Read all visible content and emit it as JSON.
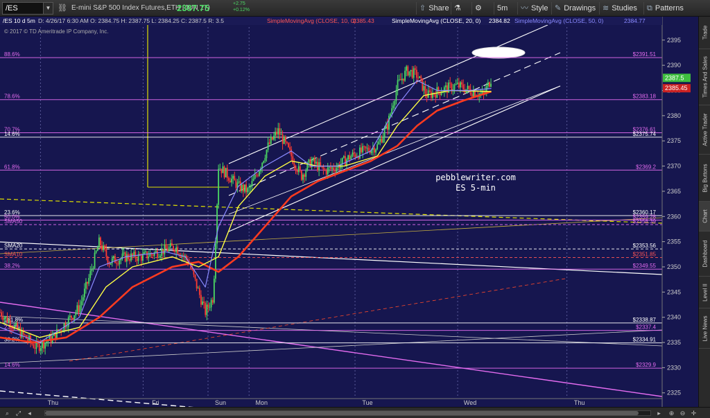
{
  "toolbar": {
    "symbol": "/ES",
    "symbol_dropdown": "▼",
    "description": "E-mini S&P 500 Index Futures,ETH (JUN 17)",
    "last_price": "2387.75",
    "change_top": "+2.75",
    "change_bottom": "+0.12%",
    "share_label": "Share",
    "timeframe_label": "5m",
    "style_label": "Style",
    "drawings_label": "Drawings",
    "studies_label": "Studies",
    "patterns_label": "Patterns",
    "icons": [
      "link-icon",
      "flask-icon",
      "gear-icon",
      "share-icon",
      "drawings-icon",
      "studies-icon",
      "patterns-icon"
    ]
  },
  "legend": {
    "header": "/ES 10 d 5m",
    "ohlc": "D: 4/26/17 6:30 AM   O: 2384.75   H: 2387.75   L: 2384.25   C: 2387.5   R: 3.5",
    "sma10_label": "SimpleMovingAvg (CLOSE, 10, 0)",
    "sma10_value": "2385.43",
    "sma20_label": "SimpleMovingAvg (CLOSE, 20, 0)",
    "sma20_value": "2384.82",
    "sma50_label": "SimpleMovingAvg (CLOSE, 50, 0)",
    "sma50_value": "2384.77",
    "copyright": "© 2017 © TD Ameritrade IP Company, Inc."
  },
  "watermark": {
    "line1": "pebblewriter.com",
    "line2": "ES 5-min"
  },
  "y_axis": {
    "min": 2324,
    "max": 2398,
    "ticks": [
      2395,
      2390,
      2385,
      2380,
      2375,
      2370,
      2365,
      2360,
      2355,
      2350,
      2345,
      2340,
      2335,
      2330,
      2325
    ]
  },
  "price_tags": [
    {
      "value": "2387.5",
      "color": "#3fbf3f"
    },
    {
      "value": "2385.45",
      "color": "#cc2222"
    }
  ],
  "x_axis": {
    "labels": [
      {
        "text": "Thu",
        "pos": 0.08
      },
      {
        "text": "Fri",
        "pos": 0.235
      },
      {
        "text": "Sun",
        "pos": 0.333
      },
      {
        "text": "Mon",
        "pos": 0.395
      },
      {
        "text": "Tue",
        "pos": 0.555
      },
      {
        "text": "Wed",
        "pos": 0.71
      },
      {
        "text": "Thu",
        "pos": 0.875
      }
    ]
  },
  "levels": [
    {
      "label": "88.6%",
      "value_text": "$2391.51",
      "price": 2391.51,
      "color": "#e46cf0",
      "style": "solid"
    },
    {
      "label": "78.6%",
      "value_text": "$2383.18",
      "price": 2383.18,
      "color": "#e46cf0",
      "style": "solid"
    },
    {
      "label": "70.7%",
      "value_text": "$2376.61",
      "price": 2376.61,
      "color": "#e46cf0",
      "style": "solid"
    },
    {
      "label": "14.6%",
      "value_text": "$2375.74",
      "price": 2375.74,
      "color": "#ffffff",
      "style": "solid"
    },
    {
      "label": "61.8%",
      "value_text": "$2369.2",
      "price": 2369.2,
      "color": "#e46cf0",
      "style": "solid"
    },
    {
      "label": "23.6%",
      "value_text": "$2360.17",
      "price": 2360.17,
      "color": "#ffffff",
      "style": "solid"
    },
    {
      "label": "50.0%",
      "value_text": "$2359.28",
      "price": 2359.28,
      "color": "#e46cf0",
      "style": "solid"
    },
    {
      "label": "SMA50",
      "value_text": "$2358.39",
      "price": 2358.39,
      "color": "#e46cf0",
      "style": "dashed"
    },
    {
      "label": "SMA20",
      "value_text": "$2353.56",
      "price": 2353.56,
      "color": "#ffffff",
      "style": "dashed"
    },
    {
      "label": "SMA10",
      "value_text": "$2351.85",
      "price": 2351.85,
      "color": "#ff5555",
      "style": "dashed"
    },
    {
      "label": "38.2%",
      "value_text": "$2349.55",
      "price": 2349.55,
      "color": "#e46cf0",
      "style": "solid"
    },
    {
      "label": "161.8%",
      "value_text": "$2338.87",
      "price": 2338.87,
      "color": "#ffffff",
      "style": "solid"
    },
    {
      "label": "23.6%",
      "value_text": "$2337.4",
      "price": 2337.4,
      "color": "#e46cf0",
      "style": "solid"
    },
    {
      "label": "38.2%",
      "value_text": "$2334.91",
      "price": 2334.91,
      "color": "#ffffff",
      "style": "solid"
    },
    {
      "label": "14.6%",
      "value_text": "$2329.9",
      "price": 2329.9,
      "color": "#e46cf0",
      "style": "solid"
    }
  ],
  "side_tabs": [
    "Trade",
    "Times And Sales",
    "Active Trader",
    "Big Buttons",
    "Chart",
    "Dashboard",
    "Level II",
    "Live News"
  ],
  "active_side_tab": "Chart",
  "chart_data": {
    "type": "candlestick",
    "interval": "5m",
    "period": "10 d",
    "ylim": [
      2324,
      2398
    ],
    "series_path": [
      [
        0.0,
        2341
      ],
      [
        0.03,
        2337
      ],
      [
        0.055,
        2334
      ],
      [
        0.08,
        2336
      ],
      [
        0.1,
        2339
      ],
      [
        0.12,
        2342
      ],
      [
        0.135,
        2348
      ],
      [
        0.15,
        2355
      ],
      [
        0.165,
        2351
      ],
      [
        0.19,
        2352
      ],
      [
        0.215,
        2352
      ],
      [
        0.24,
        2353
      ],
      [
        0.265,
        2354
      ],
      [
        0.285,
        2351
      ],
      [
        0.3,
        2345
      ],
      [
        0.31,
        2341
      ],
      [
        0.322,
        2344
      ],
      [
        0.33,
        2370
      ],
      [
        0.345,
        2368
      ],
      [
        0.36,
        2366
      ],
      [
        0.375,
        2365
      ],
      [
        0.39,
        2369
      ],
      [
        0.405,
        2374
      ],
      [
        0.42,
        2377
      ],
      [
        0.44,
        2372
      ],
      [
        0.455,
        2368
      ],
      [
        0.47,
        2371
      ],
      [
        0.49,
        2369
      ],
      [
        0.51,
        2370
      ],
      [
        0.53,
        2372
      ],
      [
        0.55,
        2373
      ],
      [
        0.57,
        2374
      ],
      [
        0.585,
        2378
      ],
      [
        0.6,
        2386
      ],
      [
        0.615,
        2389
      ],
      [
        0.63,
        2388
      ],
      [
        0.645,
        2384
      ],
      [
        0.665,
        2385
      ],
      [
        0.69,
        2386
      ],
      [
        0.71,
        2385
      ],
      [
        0.73,
        2384
      ],
      [
        0.742,
        2387.5
      ]
    ],
    "sma10": [
      [
        0.0,
        2338
      ],
      [
        0.06,
        2335
      ],
      [
        0.12,
        2340
      ],
      [
        0.15,
        2350
      ],
      [
        0.19,
        2352
      ],
      [
        0.25,
        2353
      ],
      [
        0.28,
        2352
      ],
      [
        0.31,
        2346
      ],
      [
        0.33,
        2358
      ],
      [
        0.36,
        2366
      ],
      [
        0.4,
        2370
      ],
      [
        0.44,
        2373
      ],
      [
        0.47,
        2370
      ],
      [
        0.51,
        2370
      ],
      [
        0.56,
        2373
      ],
      [
        0.6,
        2382
      ],
      [
        0.63,
        2387
      ],
      [
        0.66,
        2385
      ],
      [
        0.71,
        2385
      ],
      [
        0.742,
        2385.4
      ]
    ],
    "sma20": [
      [
        0.0,
        2339
      ],
      [
        0.06,
        2336
      ],
      [
        0.12,
        2338
      ],
      [
        0.16,
        2346
      ],
      [
        0.2,
        2350
      ],
      [
        0.26,
        2352
      ],
      [
        0.3,
        2350
      ],
      [
        0.33,
        2352
      ],
      [
        0.36,
        2362
      ],
      [
        0.4,
        2368
      ],
      [
        0.44,
        2371
      ],
      [
        0.48,
        2370
      ],
      [
        0.52,
        2370
      ],
      [
        0.57,
        2372
      ],
      [
        0.6,
        2378
      ],
      [
        0.64,
        2384
      ],
      [
        0.68,
        2385
      ],
      [
        0.742,
        2384.8
      ]
    ],
    "sma50": [
      [
        0.0,
        2336
      ],
      [
        0.05,
        2335
      ],
      [
        0.1,
        2336
      ],
      [
        0.15,
        2340
      ],
      [
        0.2,
        2346
      ],
      [
        0.26,
        2350
      ],
      [
        0.3,
        2351
      ],
      [
        0.33,
        2349
      ],
      [
        0.36,
        2352
      ],
      [
        0.4,
        2358
      ],
      [
        0.44,
        2364
      ],
      [
        0.48,
        2367
      ],
      [
        0.52,
        2369
      ],
      [
        0.56,
        2371
      ],
      [
        0.6,
        2374
      ],
      [
        0.63,
        2378
      ],
      [
        0.66,
        2381
      ],
      [
        0.7,
        2383
      ],
      [
        0.742,
        2384.8
      ]
    ]
  },
  "colors": {
    "background": "#16164f",
    "up_candle": "#4cd964",
    "down_candle": "#ff3b30",
    "sma10": "#8a8aff",
    "sma20": "#ffff44",
    "sma50": "#ff3b1f",
    "fib": "#e46cf0",
    "axis_text": "#cccccc"
  },
  "bottom_icons": [
    "magnifier-icon",
    "fit-icon",
    "scroll-left-icon",
    "scroll-right-icon",
    "zoom-in-icon",
    "zoom-out-icon",
    "crosshair-icon"
  ],
  "scroll": {
    "thumb_fraction": 0.98
  }
}
